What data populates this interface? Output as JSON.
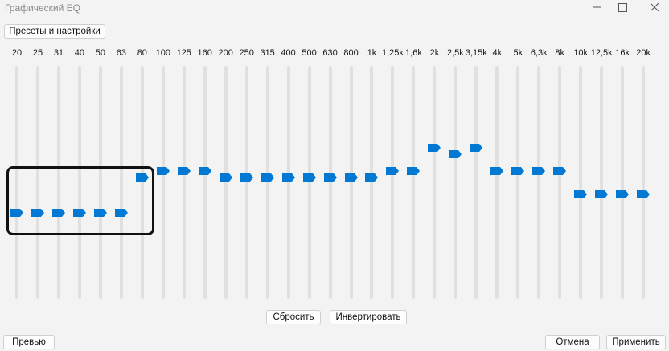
{
  "window": {
    "title": "Графический EQ"
  },
  "icons": {
    "minimize": "minimize-icon",
    "maximize": "maximize-icon",
    "close": "close-icon",
    "thumb": "slider-thumb-arrow"
  },
  "colors": {
    "accent": "#0078d4"
  },
  "toolbar": {
    "presets_label": "Пресеты и настройки"
  },
  "bands": [
    {
      "label": "20",
      "level": 0.37
    },
    {
      "label": "25",
      "level": 0.37
    },
    {
      "label": "31",
      "level": 0.37
    },
    {
      "label": "40",
      "level": 0.37
    },
    {
      "label": "50",
      "level": 0.37
    },
    {
      "label": "63",
      "level": 0.37
    },
    {
      "label": "80",
      "level": 0.52
    },
    {
      "label": "100",
      "level": 0.55
    },
    {
      "label": "125",
      "level": 0.55
    },
    {
      "label": "160",
      "level": 0.55
    },
    {
      "label": "200",
      "level": 0.52
    },
    {
      "label": "250",
      "level": 0.52
    },
    {
      "label": "315",
      "level": 0.52
    },
    {
      "label": "400",
      "level": 0.52
    },
    {
      "label": "500",
      "level": 0.52
    },
    {
      "label": "630",
      "level": 0.52
    },
    {
      "label": "800",
      "level": 0.52
    },
    {
      "label": "1k",
      "level": 0.52
    },
    {
      "label": "1,25k",
      "level": 0.55
    },
    {
      "label": "1,6k",
      "level": 0.55
    },
    {
      "label": "2k",
      "level": 0.65
    },
    {
      "label": "2,5k",
      "level": 0.62
    },
    {
      "label": "3,15k",
      "level": 0.65
    },
    {
      "label": "4k",
      "level": 0.55
    },
    {
      "label": "5k",
      "level": 0.55
    },
    {
      "label": "6,3k",
      "level": 0.55
    },
    {
      "label": "8k",
      "level": 0.55
    },
    {
      "label": "10k",
      "level": 0.45
    },
    {
      "label": "12,5k",
      "level": 0.45
    },
    {
      "label": "16k",
      "level": 0.45
    },
    {
      "label": "20k",
      "level": 0.45
    }
  ],
  "actions": {
    "reset_label": "Сбросить",
    "invert_label": "Инвертировать"
  },
  "footer": {
    "preview_label": "Превью",
    "cancel_label": "Отмена",
    "apply_label": "Применить"
  }
}
